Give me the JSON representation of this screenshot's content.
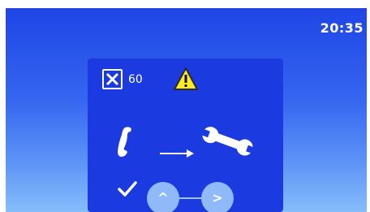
{
  "status_bar": {
    "time": "20:35"
  },
  "dialog": {
    "timer_icon": "close-box-icon",
    "timer_value": "60",
    "warning_icon": "warning-triangle-icon",
    "handset_icon": "phone-handset-icon",
    "arrow_icon": "arrow-right-icon",
    "wrench_icon": "wrench-icon",
    "check_icon": "checkmark-icon",
    "nav": {
      "up_label": "^",
      "next_label": ">"
    }
  },
  "colors": {
    "background_top": "#1f45e6",
    "background_bottom": "#86bdfb",
    "panel": "#1b3ae0",
    "warning_yellow": "#ffeb1f",
    "button": "#8fb9f8"
  }
}
